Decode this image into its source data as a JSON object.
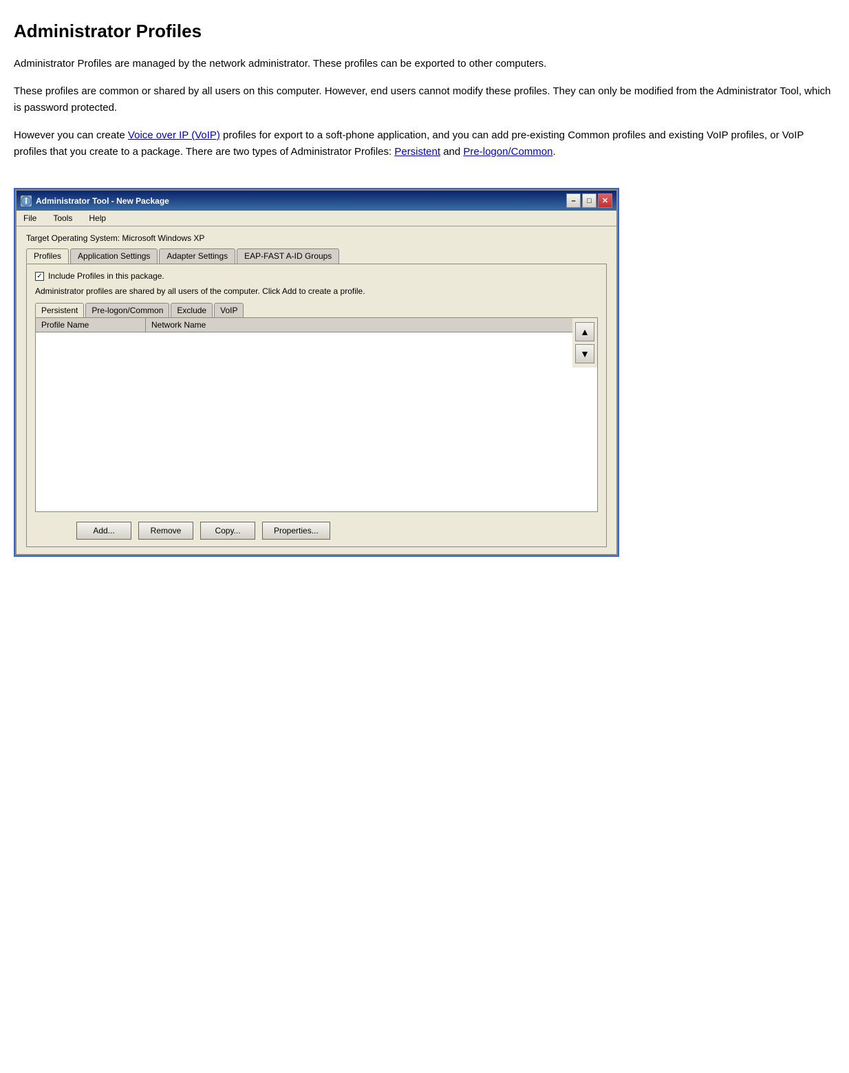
{
  "page": {
    "title": "Administrator Profiles",
    "paragraphs": [
      "Administrator Profiles are managed by the network administrator. These profiles can be exported to other computers.",
      "These profiles are common or shared by all users on this computer. However, end users cannot modify these profiles. They can only be modified from the Administrator Tool, which is password protected.",
      "However you can create {voip_link} profiles for export to a soft-phone application, and you can add pre-existing Common profiles and existing VoIP profiles, or VoIP profiles that you create to a package. There are two types of Administrator Profiles: {persistent_link} and {prelogon_link}."
    ],
    "voip_link_text": "Voice over IP (VoIP)",
    "persistent_link_text": "Persistent",
    "prelogon_link_text": "Pre-logon/Common"
  },
  "window": {
    "title": "Administrator Tool - New Package",
    "menubar": [
      "File",
      "Tools",
      "Help"
    ],
    "target_os": "Target Operating System: Microsoft Windows XP",
    "tabs": [
      "Profiles",
      "Application Settings",
      "Adapter Settings",
      "EAP-FAST A-ID Groups"
    ],
    "active_tab": "Profiles",
    "include_profiles_label": "Include Profiles in this package.",
    "admin_desc": "Administrator profiles are shared by all users of the computer. Click Add to create a profile.",
    "inner_tabs": [
      "Persistent",
      "Pre-logon/Common",
      "Exclude",
      "VoIP"
    ],
    "active_inner_tab": "Persistent",
    "table_headers": [
      "Profile Name",
      "Network Name"
    ],
    "buttons": {
      "add": "Add...",
      "remove": "Remove",
      "copy": "Copy...",
      "properties": "Properties..."
    },
    "titlebar_buttons": {
      "minimize": "–",
      "maximize": "□",
      "close": "✕"
    }
  }
}
